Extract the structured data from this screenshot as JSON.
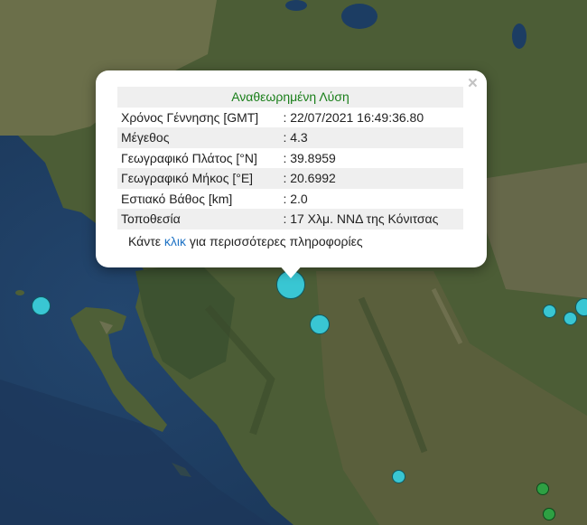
{
  "popup": {
    "close_symbol": "×",
    "title": "Αναθεωρημένη Λύση",
    "rows": [
      {
        "label": "Χρόνος Γέννησης [GMT]",
        "value": ": 22/07/2021 16:49:36.80"
      },
      {
        "label": "Μέγεθος",
        "value": ": 4.3"
      },
      {
        "label": "Γεωγραφικό Πλάτος [°N]",
        "value": ": 39.8959"
      },
      {
        "label": "Γεωγραφικό Μήκος [°E]",
        "value": ": 20.6992"
      },
      {
        "label": "Εστιακό Βάθος [km]",
        "value": ": 2.0"
      },
      {
        "label": "Τοποθεσία",
        "value": ": 17 Χλμ. ΝΝΔ της Κόνιτσας"
      }
    ],
    "more_prefix": "Κάντε ",
    "more_link": "κλικ",
    "more_suffix": " για περισσότερες πληροφορίες"
  },
  "map": {
    "sea_color": "#1e3a5c",
    "land_color": "#4a5a35",
    "marker_colors": {
      "cyan": "#39c6d3",
      "green": "#2ea043"
    }
  }
}
